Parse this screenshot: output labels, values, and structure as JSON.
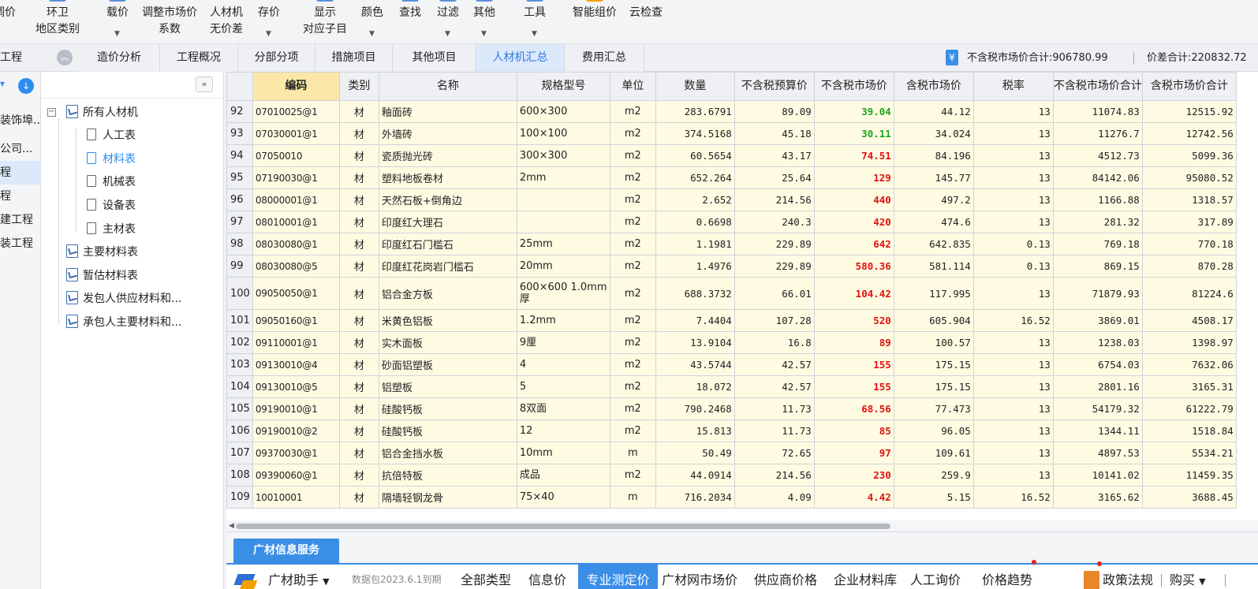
{
  "toolbar": {
    "items": [
      {
        "l1": "调价",
        "l2": "",
        "caret": false
      },
      {
        "l1": "环卫",
        "l2": "地区类别",
        "caret": false
      },
      {
        "l1": "载价",
        "l2": "",
        "caret": true
      },
      {
        "l1": "调整市场价",
        "l2": "系数",
        "caret": false
      },
      {
        "l1": "人材机",
        "l2": "无价差",
        "caret": false
      },
      {
        "l1": "存价",
        "l2": "",
        "caret": true
      },
      {
        "l1": "显示",
        "l2": "对应子目",
        "caret": false
      },
      {
        "l1": "颜色",
        "l2": "",
        "caret": true
      },
      {
        "l1": "查找",
        "l2": "",
        "caret": false
      },
      {
        "l1": "过滤",
        "l2": "",
        "caret": true
      },
      {
        "l1": "其他",
        "l2": "",
        "caret": true
      },
      {
        "l1": "工具",
        "l2": "",
        "caret": true
      },
      {
        "l1": "智能组价",
        "l2": "",
        "caret": false
      },
      {
        "l1": "云检查",
        "l2": "",
        "caret": false
      }
    ]
  },
  "tabbar": {
    "left_title": "工程",
    "tabs": [
      "造价分析",
      "工程概况",
      "分部分项",
      "措施项目",
      "其他项目",
      "人材机汇总",
      "费用汇总"
    ],
    "active_tab": "人材机汇总",
    "sum_label_1": "不含税市场价合计:906780.99",
    "sum_label_2": "价差合计:220832.72"
  },
  "left_strip": {
    "items": [
      "装饰埠...",
      "公司...",
      "程",
      "程",
      "建工程",
      "装工程"
    ],
    "selected_index": 2
  },
  "tree": {
    "root": "所有人材机",
    "children": [
      "人工表",
      "材料表",
      "机械表",
      "设备表",
      "主材表"
    ],
    "selected": "材料表",
    "others": [
      "主要材料表",
      "暂估材料表",
      "发包人供应材料和...",
      "承包人主要材料和..."
    ]
  },
  "grid": {
    "columns": [
      "",
      "编码",
      "类别",
      "名称",
      "规格型号",
      "单位",
      "数量",
      "不含税预算价",
      "不含税市场价",
      "含税市场价",
      "税率",
      "不含税市场价合计",
      "含税市场价合计"
    ],
    "sorted_column": "编码",
    "rows": [
      {
        "no": "92",
        "code": "07010025@1",
        "type": "材",
        "name": "釉面砖",
        "spec": "600×300",
        "unit": "m2",
        "qty": "283.6791",
        "budget": "89.09",
        "market": "39.04",
        "market_color": "green",
        "tax_market": "44.12",
        "rate": "13",
        "total_ex": "11074.83",
        "total_in": "12515.92"
      },
      {
        "no": "93",
        "code": "07030001@1",
        "type": "材",
        "name": "外墙砖",
        "spec": "100×100",
        "unit": "m2",
        "qty": "374.5168",
        "budget": "45.18",
        "market": "30.11",
        "market_color": "green",
        "tax_market": "34.024",
        "rate": "13",
        "total_ex": "11276.7",
        "total_in": "12742.56"
      },
      {
        "no": "94",
        "code": "07050010",
        "type": "材",
        "name": "瓷质抛光砖",
        "spec": "300×300",
        "unit": "m2",
        "qty": "60.5654",
        "budget": "43.17",
        "market": "74.51",
        "market_color": "red",
        "tax_market": "84.196",
        "rate": "13",
        "total_ex": "4512.73",
        "total_in": "5099.36"
      },
      {
        "no": "95",
        "code": "07190030@1",
        "type": "材",
        "name": "塑料地板卷材",
        "spec": "2mm",
        "unit": "m2",
        "qty": "652.264",
        "budget": "25.64",
        "market": "129",
        "market_color": "red",
        "tax_market": "145.77",
        "rate": "13",
        "total_ex": "84142.06",
        "total_in": "95080.52"
      },
      {
        "no": "96",
        "code": "08000001@1",
        "type": "材",
        "name": "天然石板+倒角边",
        "spec": "",
        "unit": "m2",
        "qty": "2.652",
        "budget": "214.56",
        "market": "440",
        "market_color": "red",
        "tax_market": "497.2",
        "rate": "13",
        "total_ex": "1166.88",
        "total_in": "1318.57"
      },
      {
        "no": "97",
        "code": "08010001@1",
        "type": "材",
        "name": "印度红大理石",
        "spec": "",
        "unit": "m2",
        "qty": "0.6698",
        "budget": "240.3",
        "market": "420",
        "market_color": "red",
        "tax_market": "474.6",
        "rate": "13",
        "total_ex": "281.32",
        "total_in": "317.89"
      },
      {
        "no": "98",
        "code": "08030080@1",
        "type": "材",
        "name": "印度红石门槛石",
        "spec": "25mm",
        "unit": "m2",
        "qty": "1.1981",
        "budget": "229.89",
        "market": "642",
        "market_color": "red",
        "tax_market": "642.835",
        "rate": "0.13",
        "total_ex": "769.18",
        "total_in": "770.18"
      },
      {
        "no": "99",
        "code": "08030080@5",
        "type": "材",
        "name": "印度红花岗岩门槛石",
        "spec": "20mm",
        "unit": "m2",
        "qty": "1.4976",
        "budget": "229.89",
        "market": "580.36",
        "market_color": "red",
        "tax_market": "581.114",
        "rate": "0.13",
        "total_ex": "869.15",
        "total_in": "870.28"
      },
      {
        "no": "100",
        "code": "09050050@1",
        "type": "材",
        "name": "铝合金方板",
        "spec": "600×600 1.0mm厚",
        "unit": "m2",
        "qty": "688.3732",
        "budget": "66.01",
        "market": "104.42",
        "market_color": "red",
        "tax_market": "117.995",
        "rate": "13",
        "total_ex": "71879.93",
        "total_in": "81224.6",
        "tall": true
      },
      {
        "no": "101",
        "code": "09050160@1",
        "type": "材",
        "name": "米黄色铝板",
        "spec": "1.2mm",
        "unit": "m2",
        "qty": "7.4404",
        "budget": "107.28",
        "market": "520",
        "market_color": "red",
        "tax_market": "605.904",
        "rate": "16.52",
        "total_ex": "3869.01",
        "total_in": "4508.17"
      },
      {
        "no": "102",
        "code": "09110001@1",
        "type": "材",
        "name": "实木面板",
        "spec": "9厘",
        "unit": "m2",
        "qty": "13.9104",
        "budget": "16.8",
        "market": "89",
        "market_color": "red",
        "tax_market": "100.57",
        "rate": "13",
        "total_ex": "1238.03",
        "total_in": "1398.97"
      },
      {
        "no": "103",
        "code": "09130010@4",
        "type": "材",
        "name": "砂面铝塑板",
        "spec": "4",
        "unit": "m2",
        "qty": "43.5744",
        "budget": "42.57",
        "market": "155",
        "market_color": "red",
        "tax_market": "175.15",
        "rate": "13",
        "total_ex": "6754.03",
        "total_in": "7632.06"
      },
      {
        "no": "104",
        "code": "09130010@5",
        "type": "材",
        "name": "铝塑板",
        "spec": "5",
        "unit": "m2",
        "qty": "18.072",
        "budget": "42.57",
        "market": "155",
        "market_color": "red",
        "tax_market": "175.15",
        "rate": "13",
        "total_ex": "2801.16",
        "total_in": "3165.31"
      },
      {
        "no": "105",
        "code": "09190010@1",
        "type": "材",
        "name": "硅酸钙板",
        "spec": "8双面",
        "unit": "m2",
        "qty": "790.2468",
        "budget": "11.73",
        "market": "68.56",
        "market_color": "red",
        "tax_market": "77.473",
        "rate": "13",
        "total_ex": "54179.32",
        "total_in": "61222.79"
      },
      {
        "no": "106",
        "code": "09190010@2",
        "type": "材",
        "name": "硅酸钙板",
        "spec": "12",
        "unit": "m2",
        "qty": "15.813",
        "budget": "11.73",
        "market": "85",
        "market_color": "red",
        "tax_market": "96.05",
        "rate": "13",
        "total_ex": "1344.11",
        "total_in": "1518.84"
      },
      {
        "no": "107",
        "code": "09370030@1",
        "type": "材",
        "name": "铝合金挡水板",
        "spec": "10mm",
        "unit": "m",
        "qty": "50.49",
        "budget": "72.65",
        "market": "97",
        "market_color": "red",
        "tax_market": "109.61",
        "rate": "13",
        "total_ex": "4897.53",
        "total_in": "5534.21"
      },
      {
        "no": "108",
        "code": "09390060@1",
        "type": "材",
        "name": "抗倍特板",
        "spec": "成品",
        "unit": "m2",
        "qty": "44.0914",
        "budget": "214.56",
        "market": "230",
        "market_color": "red",
        "tax_market": "259.9",
        "rate": "13",
        "total_ex": "10141.02",
        "total_in": "11459.35"
      },
      {
        "no": "109",
        "code": "10010001",
        "type": "材",
        "name": "隔墙轻钢龙骨",
        "spec": "75×40",
        "unit": "m",
        "qty": "716.2034",
        "budget": "4.09",
        "market": "4.42",
        "market_color": "red",
        "tax_market": "5.15",
        "rate": "16.52",
        "total_ex": "3165.62",
        "total_in": "3688.45"
      }
    ]
  },
  "bottom": {
    "info_tab": "广材信息服务",
    "assistant": "广材助手",
    "data_pack": "数据包2023.6.1到期",
    "items": [
      "全部类型",
      "信息价",
      "专业测定价",
      "广材网市场价",
      "供应商价格",
      "企业材料库",
      "人工询价",
      "价格趋势"
    ],
    "active_item": "专业测定价",
    "policy": "政策法规",
    "buy": "购买",
    "colors": {
      "accent": "#3a8ee6",
      "market_red": "#e01010",
      "market_green": "#1aa31a"
    }
  }
}
